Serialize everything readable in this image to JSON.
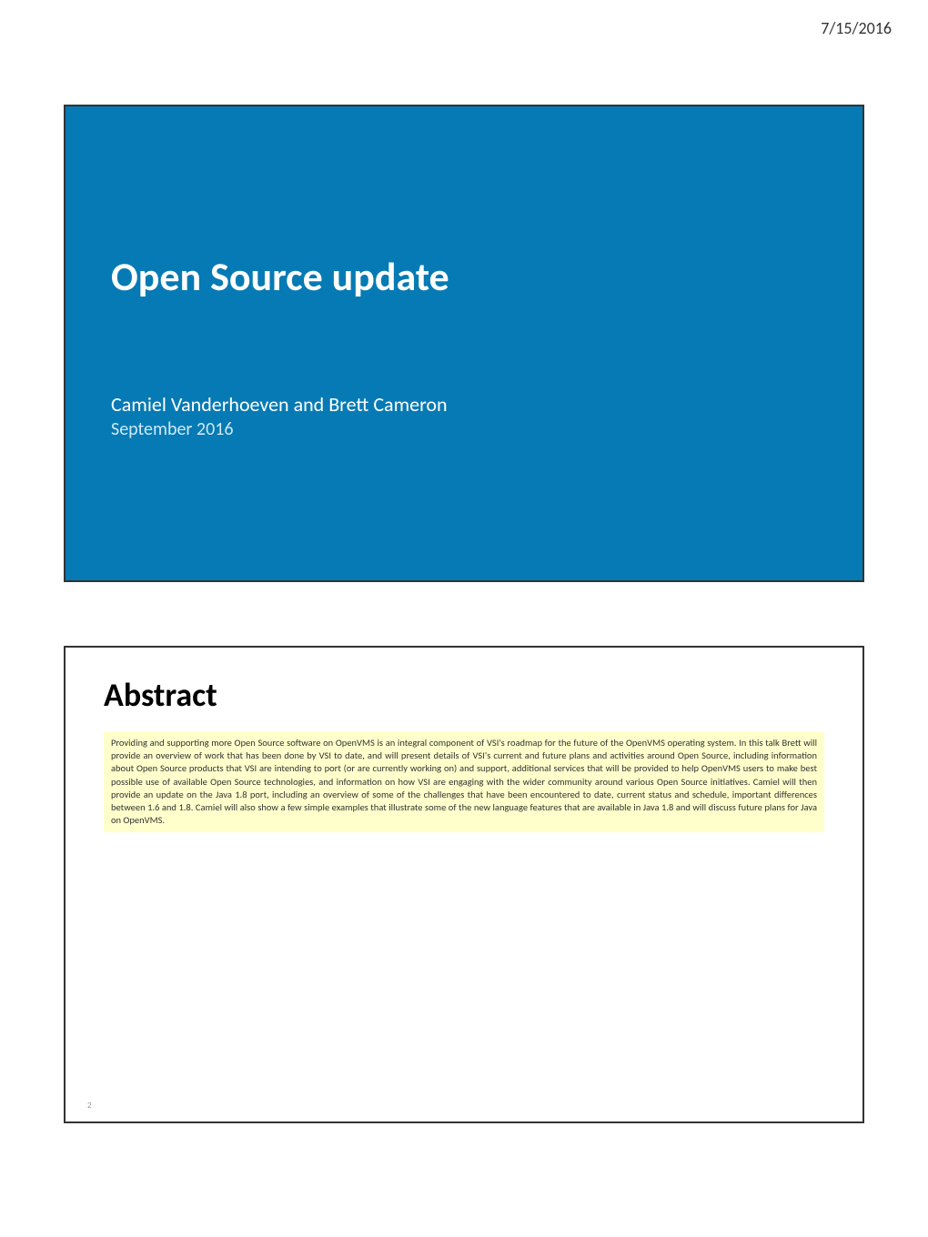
{
  "header": {
    "date": "7/15/2016"
  },
  "slide1": {
    "title": "Open Source update",
    "authors": "Camiel Vanderhoeven and Brett Cameron",
    "date": "September 2016"
  },
  "slide2": {
    "title": "Abstract",
    "body": "Providing and supporting more Open Source software on OpenVMS is an integral component of VSI's roadmap for the future of the OpenVMS operating system. In this talk Brett will provide an overview of work that has been done by VSI to date, and will present details of VSI's current and future plans and activities around Open Source, including information about Open Source products that VSI are intending to port (or are currently working on) and support, additional services that will be provided to help OpenVMS users to make best possible use of available Open Source technologies, and information on how VSI are engaging with the wider community around various Open Source initiatives. Camiel will then provide an update on the Java 1.8 port, including an overview of some of the challenges that have been encountered to date, current status and schedule, important differences between 1.6 and 1.8. Camiel will also show a few simple examples that illustrate some of the new language features that are available in Java 1.8 and will discuss future plans for Java on OpenVMS.",
    "page_number": "2"
  }
}
